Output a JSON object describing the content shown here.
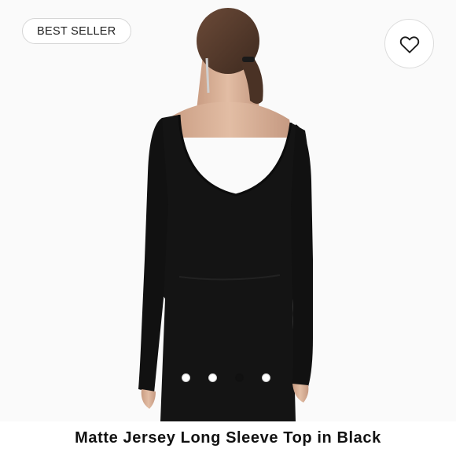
{
  "badge": {
    "label": "BEST SELLER"
  },
  "favorite": {
    "icon": "heart-outline-icon"
  },
  "carousel": {
    "total": 4,
    "active_index": 2
  },
  "product": {
    "title": "Matte Jersey Long Sleeve Top in Black"
  },
  "colors": {
    "garment": "#141414",
    "skin": "#d9b39a",
    "hair": "#5a3f30",
    "background": "#fafafa"
  }
}
